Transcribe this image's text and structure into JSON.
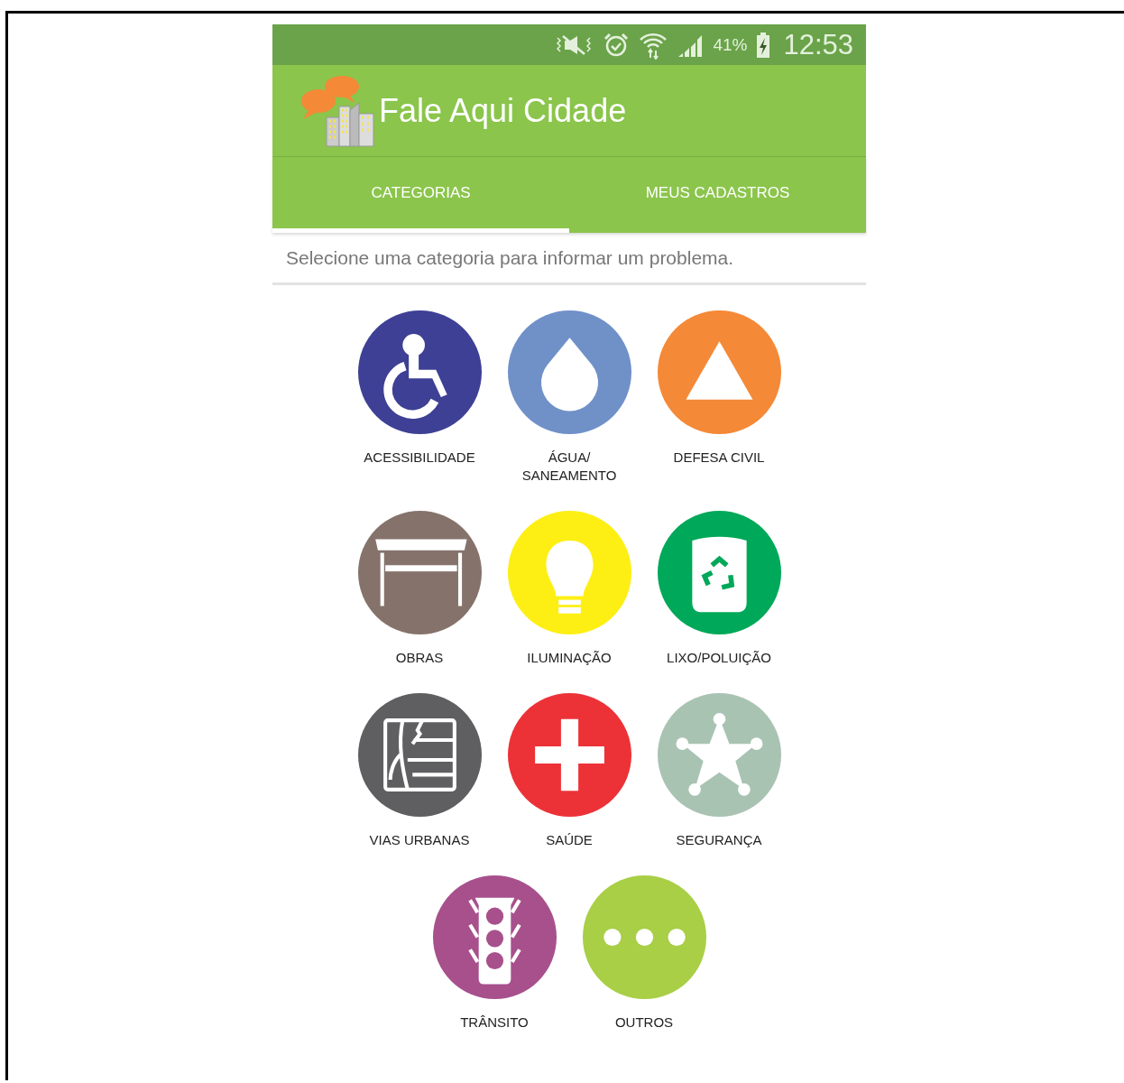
{
  "status_bar": {
    "battery": "41%",
    "time": "12:53"
  },
  "app_bar": {
    "title": "Fale Aqui Cidade"
  },
  "tabs": [
    {
      "label": "CATEGORIAS",
      "selected": true
    },
    {
      "label": "MEUS CADASTROS",
      "selected": false
    }
  ],
  "instruction": "Selecione uma categoria para informar um problema.",
  "categories": [
    {
      "label": "ACESSIBILIDADE",
      "kind": "wheelchair",
      "color": "#3e4095"
    },
    {
      "label": "ÁGUA/\nSANEAMENTO",
      "kind": "drop",
      "color": "#7090c8"
    },
    {
      "label": "DEFESA CIVIL",
      "kind": "triangle",
      "color": "#f48937"
    },
    {
      "label": "OBRAS",
      "kind": "barrier",
      "color": "#85736b"
    },
    {
      "label": "ILUMINAÇÃO",
      "kind": "bulb",
      "color": "#fdef14"
    },
    {
      "label": "LIXO/POLUIÇÃO",
      "kind": "bin",
      "color": "#00a859"
    },
    {
      "label": "VIAS URBANAS",
      "kind": "map",
      "color": "#5f5f61"
    },
    {
      "label": "SAÚDE",
      "kind": "cross",
      "color": "#ec3237"
    },
    {
      "label": "SEGURANÇA",
      "kind": "star",
      "color": "#a9c3b3"
    },
    {
      "label": "TRÂNSITO",
      "kind": "traffic",
      "color": "#a7508c"
    },
    {
      "label": "OUTROS",
      "kind": "dots",
      "color": "#a8cf45"
    }
  ]
}
